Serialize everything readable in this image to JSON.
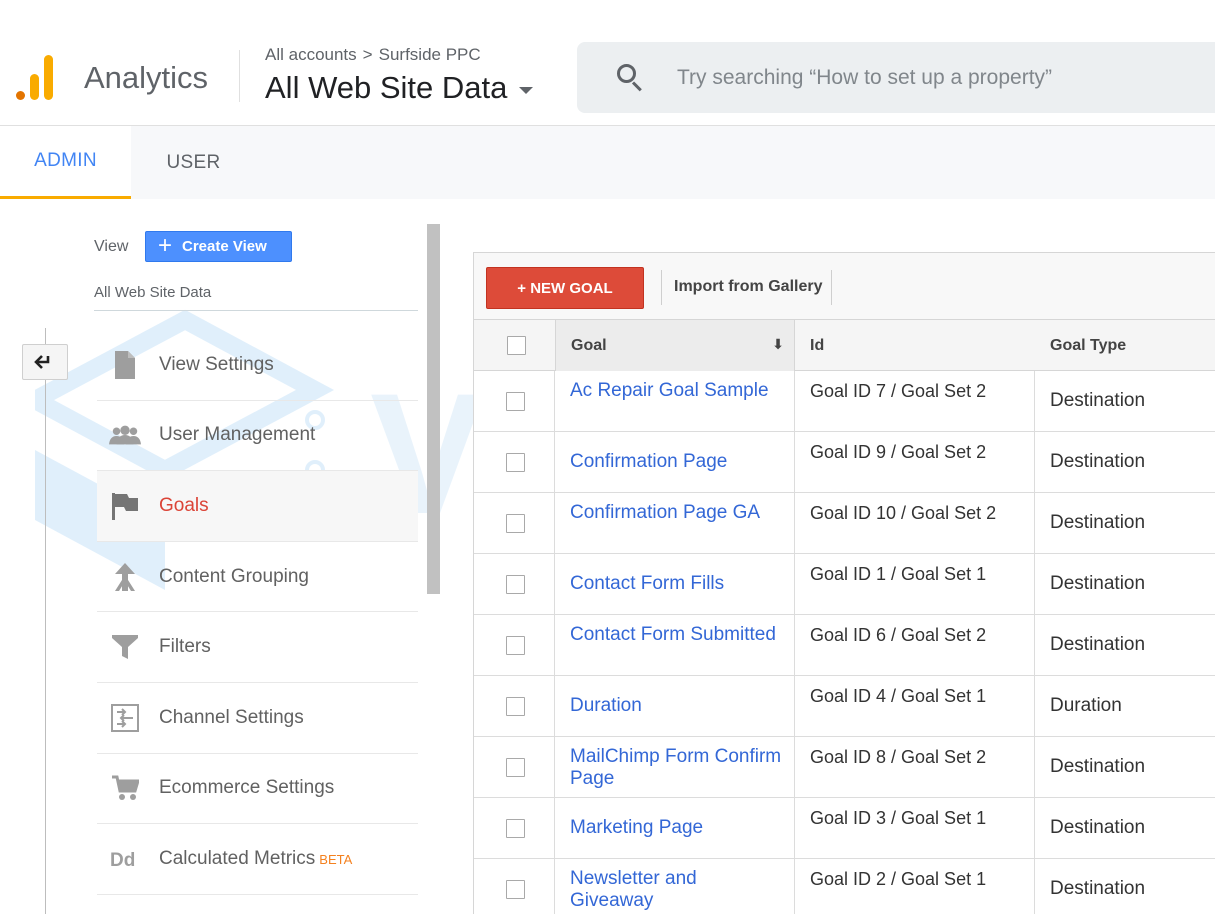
{
  "header": {
    "app_name": "Analytics",
    "breadcrumb": {
      "account": "All accounts",
      "separator": ">",
      "property": "Surfside PPC"
    },
    "view_selector": "All Web Site Data",
    "search_placeholder": "Try searching “How to set up a property”"
  },
  "tabs": [
    {
      "label": "ADMIN",
      "active": true
    },
    {
      "label": "USER",
      "active": false
    }
  ],
  "view_panel": {
    "label": "View",
    "create_view_label": "Create View",
    "view_name": "All Web Site Data",
    "nav": [
      {
        "label": "View Settings",
        "icon": "document-icon",
        "active": false
      },
      {
        "label": "User Management",
        "icon": "users-icon",
        "active": false
      },
      {
        "label": "Goals",
        "icon": "flag-icon",
        "active": true
      },
      {
        "label": "Content Grouping",
        "icon": "content-grouping-icon",
        "active": false
      },
      {
        "label": "Filters",
        "icon": "filter-icon",
        "active": false
      },
      {
        "label": "Channel Settings",
        "icon": "channel-settings-icon",
        "active": false
      },
      {
        "label": "Ecommerce Settings",
        "icon": "cart-icon",
        "active": false
      },
      {
        "label": "Calculated Metrics",
        "icon": "calculated-metrics-icon",
        "active": false,
        "badge": "BETA"
      }
    ]
  },
  "goals_table": {
    "new_goal_label": "+ NEW GOAL",
    "import_label": "Import from Gallery",
    "columns": {
      "goal": "Goal",
      "id": "Id",
      "type": "Goal Type"
    },
    "rows": [
      {
        "goal": "Ac Repair Goal Sample",
        "id": "Goal ID 7 / Goal Set 2",
        "type": "Destination"
      },
      {
        "goal": "Confirmation Page",
        "id": "Goal ID 9 / Goal Set 2",
        "type": "Destination"
      },
      {
        "goal": "Confirmation Page GA",
        "id": "Goal ID 10 / Goal Set 2",
        "type": "Destination"
      },
      {
        "goal": "Contact Form Fills",
        "id": "Goal ID 1 / Goal Set 1",
        "type": "Destination"
      },
      {
        "goal": "Contact Form Submitted",
        "id": "Goal ID 6 / Goal Set 2",
        "type": "Destination"
      },
      {
        "goal": "Duration",
        "id": "Goal ID 4 / Goal Set 1",
        "type": "Duration"
      },
      {
        "goal": "MailChimp Form Confirm Page",
        "id": "Goal ID 8 / Goal Set 2",
        "type": "Destination"
      },
      {
        "goal": "Marketing Page",
        "id": "Goal ID 3 / Goal Set 1",
        "type": "Destination"
      },
      {
        "goal": "Newsletter and Giveaway",
        "id": "Goal ID 2 / Goal Set 1",
        "type": "Destination"
      }
    ]
  },
  "watermark": "VIETNIX",
  "colors": {
    "accent_blue": "#4285f4",
    "active_red": "#db4437",
    "new_goal_red": "#dd4b39",
    "link_blue": "#3367d6",
    "logo_orange": "#f9ab00"
  }
}
